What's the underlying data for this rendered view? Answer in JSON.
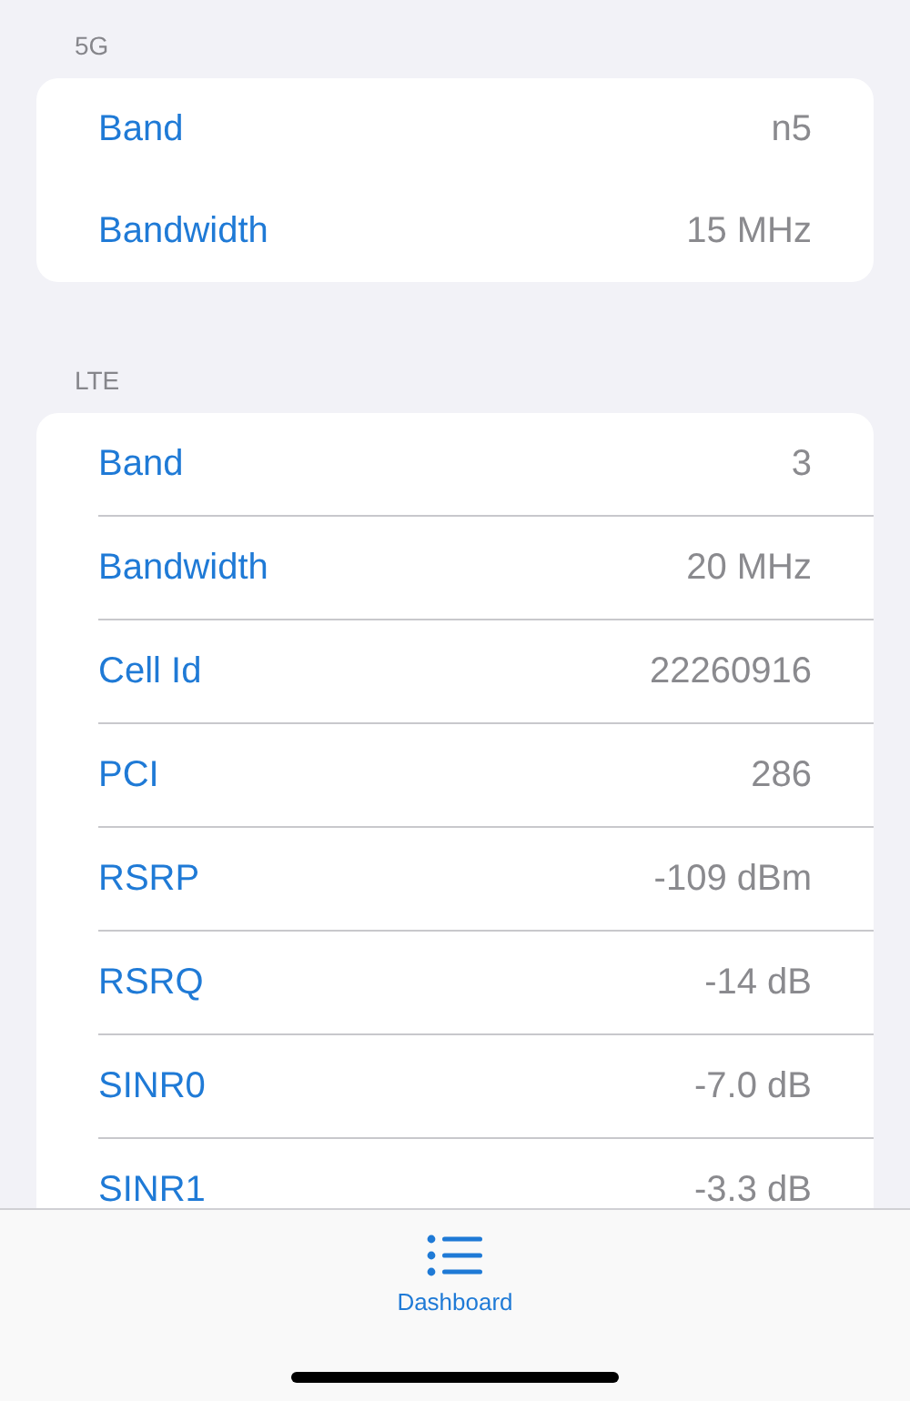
{
  "sections": [
    {
      "title": "5G",
      "separators": false,
      "rows": [
        {
          "label": "Band",
          "value": "n5"
        },
        {
          "label": "Bandwidth",
          "value": "15 MHz"
        }
      ]
    },
    {
      "title": "LTE",
      "separators": true,
      "rows": [
        {
          "label": "Band",
          "value": "3"
        },
        {
          "label": "Bandwidth",
          "value": "20 MHz"
        },
        {
          "label": "Cell Id",
          "value": "22260916"
        },
        {
          "label": "PCI",
          "value": "286"
        },
        {
          "label": "RSRP",
          "value": "-109 dBm"
        },
        {
          "label": "RSRQ",
          "value": "-14 dB"
        },
        {
          "label": "SINR0",
          "value": "-7.0 dB"
        },
        {
          "label": "SINR1",
          "value": "-3.3 dB"
        }
      ]
    }
  ],
  "tab_bar": {
    "tabs": [
      {
        "label": "Dashboard",
        "selected": true
      }
    ]
  }
}
